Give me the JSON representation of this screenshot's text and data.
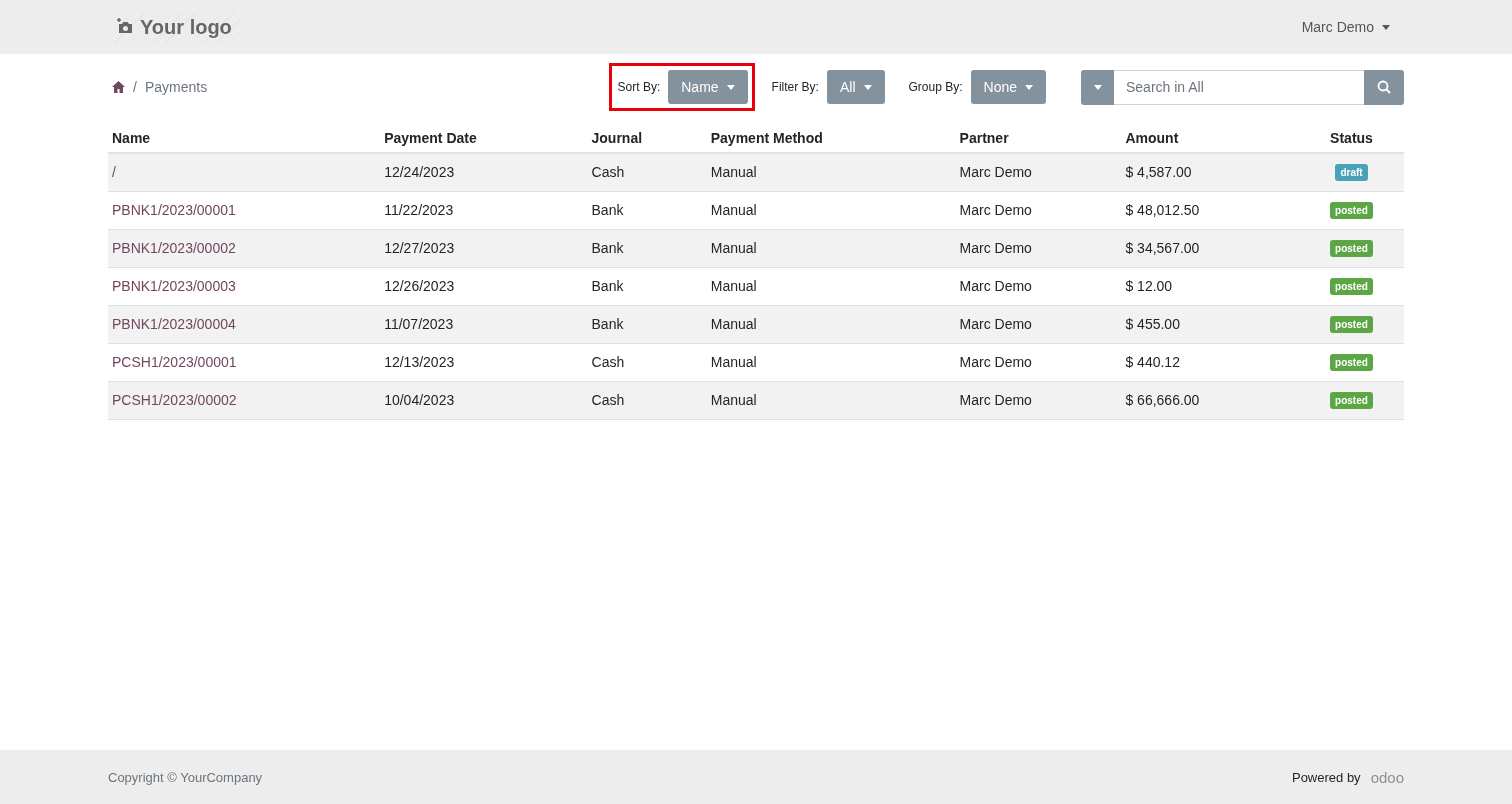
{
  "header": {
    "logo": "Your logo",
    "user": "Marc Demo"
  },
  "breadcrumb": {
    "separator": "/",
    "items": [
      "Payments"
    ]
  },
  "controls": [
    {
      "label": "Sort By:",
      "value": "Name",
      "highlighted": true
    },
    {
      "label": "Filter By:",
      "value": "All",
      "highlighted": false
    },
    {
      "label": "Group By:",
      "value": "None",
      "highlighted": false
    }
  ],
  "search": {
    "placeholder": "Search in All"
  },
  "table": {
    "columns": [
      "Name",
      "Payment Date",
      "Journal",
      "Payment Method",
      "Partner",
      "Amount",
      "Status"
    ],
    "rows": [
      {
        "name": "/",
        "date": "12/24/2023",
        "journal": "Cash",
        "method": "Manual",
        "partner": "Marc Demo",
        "amount": "$ 4,587.00",
        "status": "draft",
        "color": "#4aa2b8"
      },
      {
        "name": "PBNK1/2023/00001",
        "date": "11/22/2023",
        "journal": "Bank",
        "method": "Manual",
        "partner": "Marc Demo",
        "amount": "$ 48,012.50",
        "status": "posted",
        "color": "#5da646"
      },
      {
        "name": "PBNK1/2023/00002",
        "date": "12/27/2023",
        "journal": "Bank",
        "method": "Manual",
        "partner": "Marc Demo",
        "amount": "$ 34,567.00",
        "status": "posted",
        "color": "#5da646"
      },
      {
        "name": "PBNK1/2023/00003",
        "date": "12/26/2023",
        "journal": "Bank",
        "method": "Manual",
        "partner": "Marc Demo",
        "amount": "$ 12.00",
        "status": "posted",
        "color": "#5da646"
      },
      {
        "name": "PBNK1/2023/00004",
        "date": "11/07/2023",
        "journal": "Bank",
        "method": "Manual",
        "partner": "Marc Demo",
        "amount": "$ 455.00",
        "status": "posted",
        "color": "#5da646"
      },
      {
        "name": "PCSH1/2023/00001",
        "date": "12/13/2023",
        "journal": "Cash",
        "method": "Manual",
        "partner": "Marc Demo",
        "amount": "$ 440.12",
        "status": "posted",
        "color": "#5da646"
      },
      {
        "name": "PCSH1/2023/00002",
        "date": "10/04/2023",
        "journal": "Cash",
        "method": "Manual",
        "partner": "Marc Demo",
        "amount": "$ 66,666.00",
        "status": "posted",
        "color": "#5da646"
      }
    ]
  },
  "footer": {
    "copyright": "Copyright © YourCompany",
    "powered_by": "Powered by",
    "brand": "odoo"
  }
}
